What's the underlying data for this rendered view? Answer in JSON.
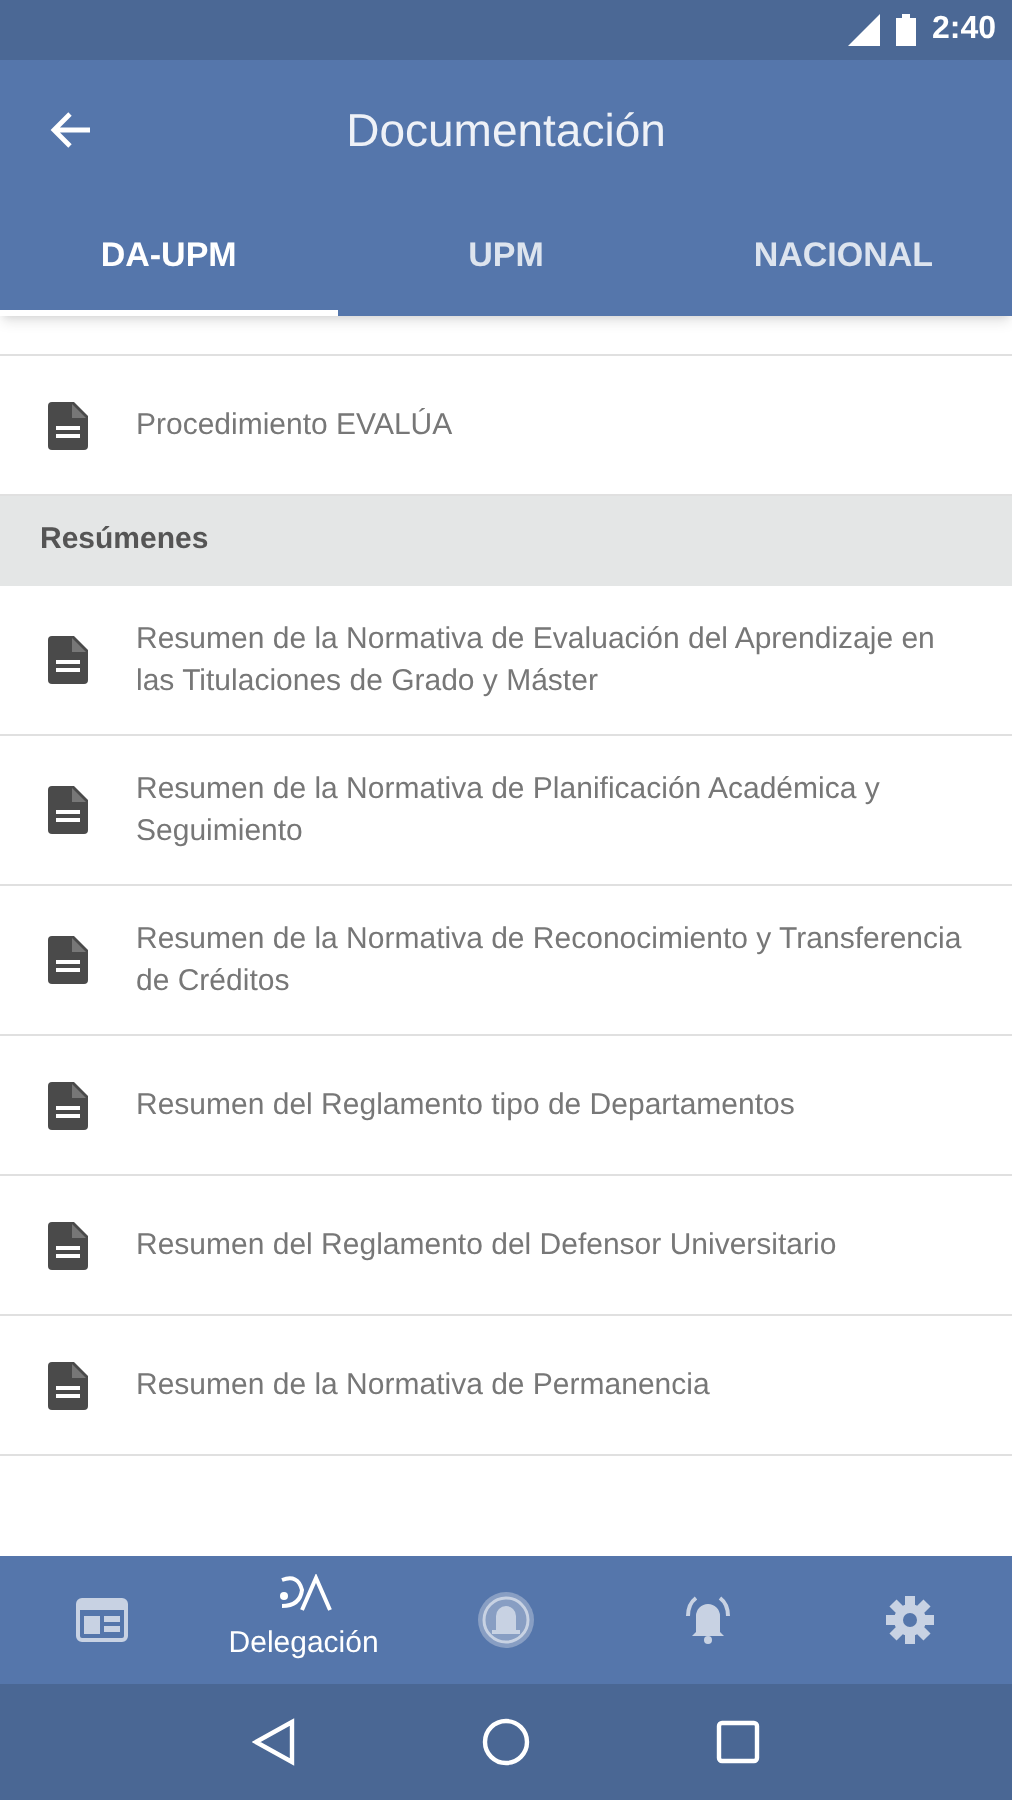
{
  "status_bar": {
    "time": "2:40"
  },
  "app_bar": {
    "title": "Documentación"
  },
  "tabs": [
    {
      "label": "DA-UPM",
      "selected": true
    },
    {
      "label": "UPM",
      "selected": false
    },
    {
      "label": "NACIONAL",
      "selected": false
    }
  ],
  "list": [
    {
      "kind": "document",
      "text": "Procedimiento EVALÚA"
    },
    {
      "kind": "header",
      "text": "Resúmenes"
    },
    {
      "kind": "document",
      "text": "Resumen de la Normativa de Evaluación del Aprendizaje en las Titulaciones de Grado y Máster"
    },
    {
      "kind": "document",
      "text": "Resumen de la Normativa de Planificación Académica y Seguimiento"
    },
    {
      "kind": "document",
      "text": "Resumen de la Normativa de Reconocimiento y Transferencia de Créditos"
    },
    {
      "kind": "document",
      "text": "Resumen del Reglamento tipo de Departamentos"
    },
    {
      "kind": "document",
      "text": "Resumen del Reglamento del Defensor Universitario"
    },
    {
      "kind": "document",
      "text": "Resumen de la Normativa de Permanencia"
    }
  ],
  "bottom_nav": [
    {
      "kind": "calendar",
      "selected": false
    },
    {
      "kind": "logo",
      "label": "Delegación",
      "selected": true
    },
    {
      "kind": "badge-bell",
      "selected": false
    },
    {
      "kind": "bell",
      "selected": false
    },
    {
      "kind": "settings",
      "selected": false
    }
  ]
}
